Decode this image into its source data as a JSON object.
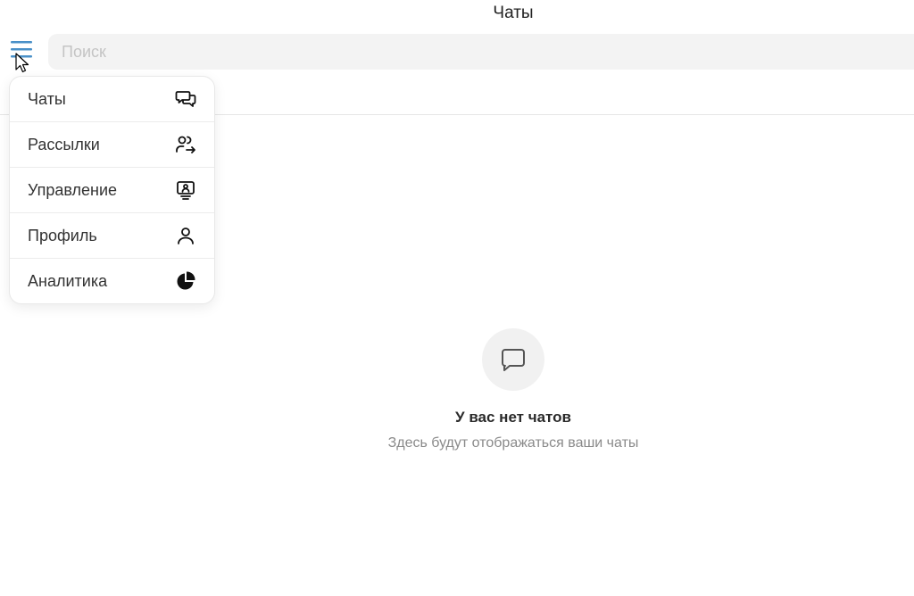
{
  "header": {
    "title": "Чаты"
  },
  "search": {
    "placeholder": "Поиск",
    "value": ""
  },
  "menu": {
    "icon": "hamburger-menu-icon",
    "accent_color": "#4a90c8",
    "items": [
      {
        "label": "Чаты",
        "icon": "chats-icon"
      },
      {
        "label": "Рассылки",
        "icon": "mailing-users-icon"
      },
      {
        "label": "Управление",
        "icon": "management-monitor-icon"
      },
      {
        "label": "Профиль",
        "icon": "profile-icon"
      },
      {
        "label": "Аналитика",
        "icon": "pie-chart-icon"
      }
    ]
  },
  "empty_state": {
    "icon": "chat-bubble-icon",
    "title": "У вас нет чатов",
    "subtitle": "Здесь будут отображаться ваши чаты"
  }
}
